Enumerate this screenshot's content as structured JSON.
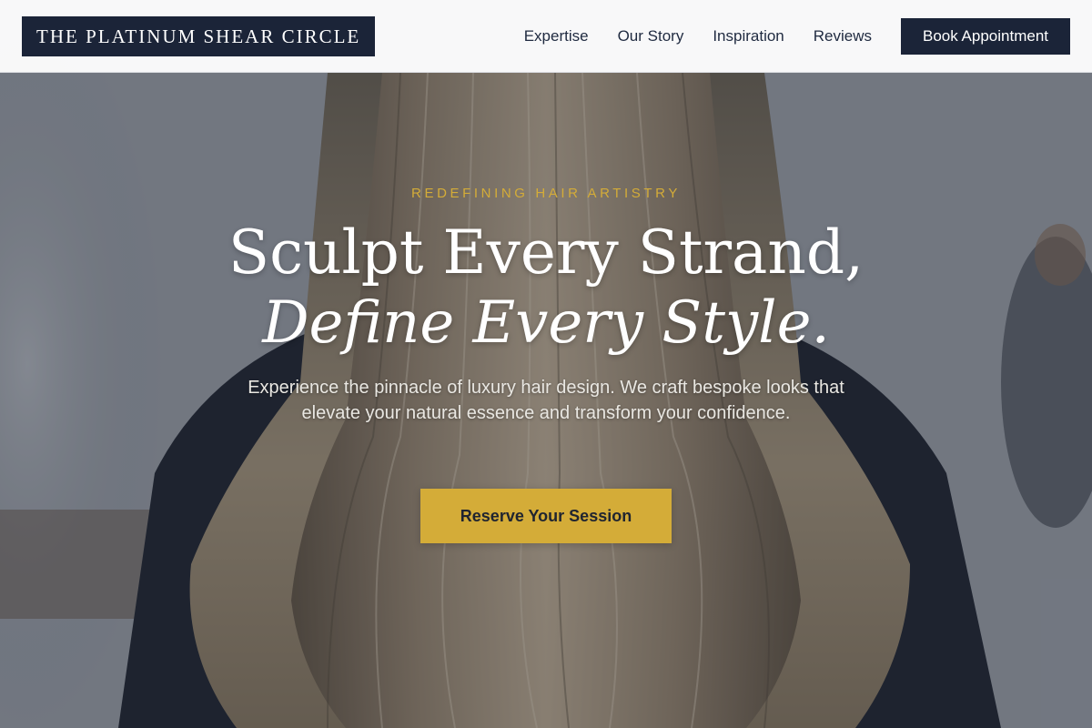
{
  "brand": {
    "name": "THE PLATINUM SHEAR CIRCLE"
  },
  "nav": {
    "links": [
      "Expertise",
      "Our Story",
      "Inspiration",
      "Reviews"
    ],
    "book_label": "Book Appointment"
  },
  "hero": {
    "eyebrow": "REDEFINING HAIR ARTISTRY",
    "headline_line1": "Sculpt Every Strand,",
    "headline_line2": "Define Every Style.",
    "subtext": "Experience the pinnacle of luxury hair design. We craft bespoke looks that elevate your natural essence and transform your confidence.",
    "cta_label": "Reserve Your Session"
  },
  "colors": {
    "navy": "#1b2438",
    "gold": "#d4ac38",
    "white": "#ffffff"
  }
}
